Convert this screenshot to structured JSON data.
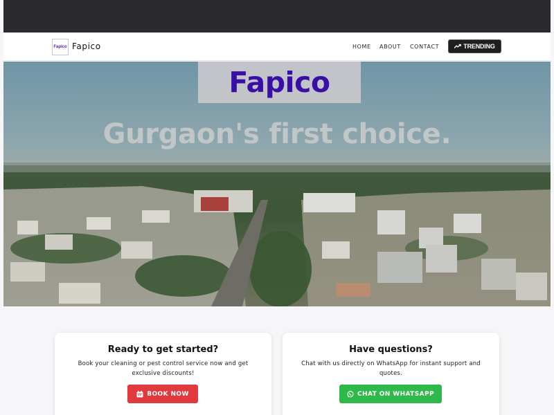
{
  "nav": {
    "logo_text": "Fapico",
    "brand": "Fapico",
    "links": [
      "HOME",
      "ABOUT",
      "CONTACT"
    ],
    "trending_label": "TRENDING"
  },
  "hero": {
    "title": "Fapico",
    "tagline": "Gurgaon's first choice."
  },
  "cards": {
    "left": {
      "title": "Ready to get started?",
      "text": "Book your cleaning or pest control service now and get exclusive discounts!",
      "button": "BOOK NOW"
    },
    "right": {
      "title": "Have questions?",
      "text": "Chat with us directly on WhatsApp for instant support and quotes.",
      "button": "CHAT ON WHATSAPP"
    }
  },
  "icons": {
    "trending": "trending-up-icon",
    "book": "calendar-icon",
    "whatsapp": "whatsapp-icon"
  },
  "colors": {
    "brand_purple": "#3a0fa5",
    "book_red": "#e0393e",
    "whatsapp_green": "#2fb94a",
    "dark_bar": "#2b2a2f"
  }
}
